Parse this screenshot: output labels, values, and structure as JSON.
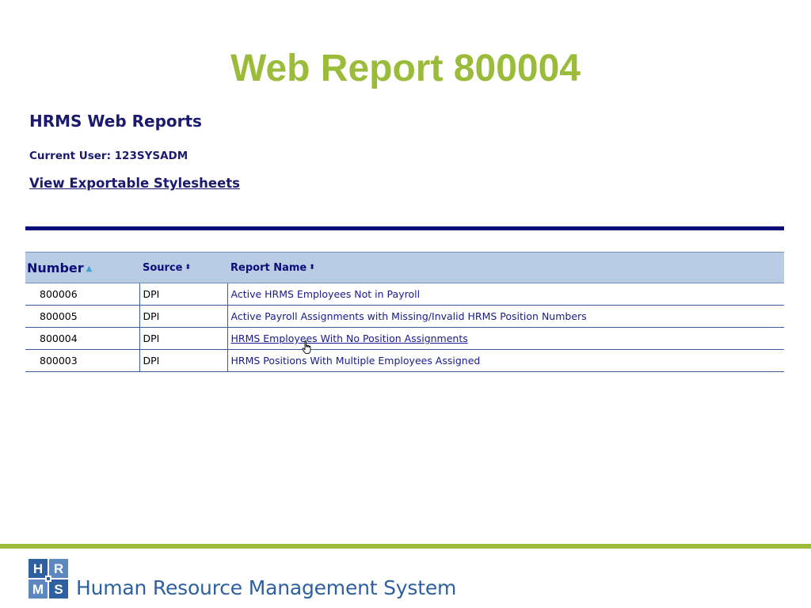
{
  "slide": {
    "title": "Web Report 800004"
  },
  "app": {
    "title": "HRMS Web Reports",
    "current_user": "Current User: 123SYSADM",
    "stylesheets_link": "View Exportable Stylesheets"
  },
  "table": {
    "headers": {
      "number": "Number",
      "source": "Source",
      "report_name": "Report Name"
    },
    "rows": [
      {
        "number": "800006",
        "source": "DPI",
        "name": "Active HRMS Employees Not in Payroll"
      },
      {
        "number": "800005",
        "source": "DPI",
        "name": "Active Payroll Assignments with Missing/Invalid HRMS Position Numbers"
      },
      {
        "number": "800004",
        "source": "DPI",
        "name": "HRMS Employees With No Position Assignments"
      },
      {
        "number": "800003",
        "source": "DPI",
        "name": "HRMS Positions With Multiple Employees Assigned"
      }
    ]
  },
  "footer": {
    "logo_letters": [
      "H",
      "R",
      "M",
      "S"
    ],
    "text": "Human Resource Management System"
  },
  "colors": {
    "title_green": "#9BBB3B",
    "navy": "#0C0C7A",
    "header_blue": "#B8CCE4",
    "footer_blue": "#2E5FA0"
  },
  "icons": {
    "sort_asc": "sort-ascending-icon",
    "sort_both": "sort-both-icon",
    "cursor": "hand-pointer-icon"
  }
}
